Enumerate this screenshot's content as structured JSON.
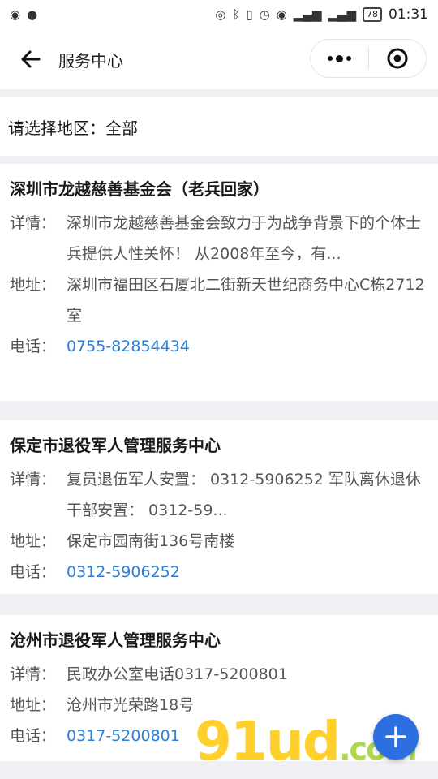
{
  "status_bar": {
    "time": "01:31",
    "battery": "78"
  },
  "nav": {
    "title": "服务中心"
  },
  "region": {
    "label": "请选择地区：",
    "value": "全部"
  },
  "cards": [
    {
      "title": "深圳市龙越慈善基金会（老兵回家）",
      "detail_label": "详情：",
      "detail": "深圳市龙越慈善基金会致力于为战争背景下的个体士兵提供人性关怀！ 从2008年至今，有...",
      "address_label": "地址：",
      "address": "深圳市福田区石厦北二街新天世纪商务中心C栋2712室",
      "phone_label": "电话：",
      "phone": "0755-82854434"
    },
    {
      "title": "保定市退役军人管理服务中心",
      "detail_label": "详情：",
      "detail": "复员退伍军人安置： 0312-5906252 军队离休退休干部安置： 0312-59...",
      "address_label": "地址：",
      "address": "保定市园南街136号南楼",
      "phone_label": "电话：",
      "phone": "0312-5906252"
    },
    {
      "title": "沧州市退役军人管理服务中心",
      "detail_label": "详情：",
      "detail": "民政办公室电话0317-5200801",
      "address_label": "地址：",
      "address": "沧州市光荣路18号",
      "phone_label": "电话：",
      "phone": "0317-5200801"
    }
  ],
  "watermark": {
    "main": "91ud",
    "domain": ".com"
  },
  "colors": {
    "link": "#2b7fd6",
    "fab": "#2d6fe0",
    "background": "#efeff4"
  },
  "icons": {
    "back": "back-arrow-icon",
    "more": "more-dots-icon",
    "close": "miniprogram-close-icon",
    "fab": "plus-icon"
  }
}
